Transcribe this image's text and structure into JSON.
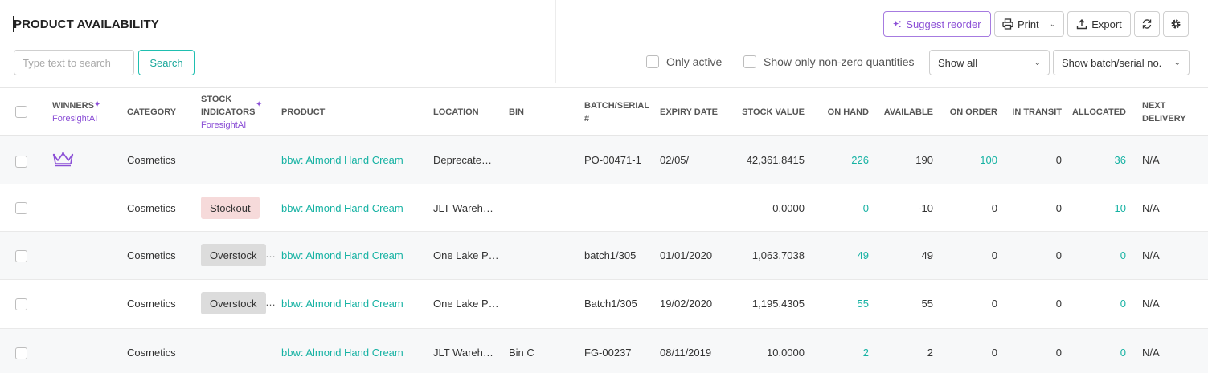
{
  "header": {
    "title": "PRODUCT AVAILABILITY",
    "search_placeholder": "Type text to search",
    "search_label": "Search",
    "suggest_label": "Suggest reorder",
    "print_label": "Print",
    "export_label": "Export",
    "only_active_label": "Only active",
    "non_zero_label": "Show only non-zero quantities",
    "show_all_value": "Show all",
    "batch_value": "Show batch/serial no."
  },
  "columns": {
    "winners": "WINNERS",
    "winners_sub": "ForesightAI",
    "category": "CATEGORY",
    "stock_indicators_1": "STOCK",
    "stock_indicators_2": "INDICATORS",
    "stock_indicators_sub": "ForesightAI",
    "product": "PRODUCT",
    "location": "LOCATION",
    "bin": "BIN",
    "batch_1": "BATCH/SERIAL",
    "batch_2": "#",
    "expiry": "EXPIRY DATE",
    "stock_value": "STOCK VALUE",
    "on_hand": "ON HAND",
    "available": "AVAILABLE",
    "on_order": "ON ORDER",
    "in_transit": "IN TRANSIT",
    "allocated": "ALLOCATED",
    "next_1": "NEXT",
    "next_2": "DELIVERY"
  },
  "rows": [
    {
      "winner": true,
      "category": "Cosmetics",
      "indicator": "",
      "indicator_type": "",
      "product": "bbw: Almond Hand Cream",
      "location": "Deprecate…",
      "bin": "",
      "batch": "PO-00471-1",
      "expiry": "02/05/",
      "stock_value": "42,361.8415",
      "on_hand": "226",
      "available": "190",
      "on_order": "100",
      "in_transit": "0",
      "allocated": "36",
      "next_delivery": "N/A"
    },
    {
      "winner": false,
      "category": "Cosmetics",
      "indicator": "Stockout",
      "indicator_type": "stockout",
      "product": "bbw: Almond Hand Cream",
      "location": "JLT Wareh…",
      "bin": "",
      "batch": "",
      "expiry": "",
      "stock_value": "0.0000",
      "on_hand": "0",
      "available": "-10",
      "on_order": "0",
      "in_transit": "0",
      "allocated": "10",
      "next_delivery": "N/A"
    },
    {
      "winner": false,
      "category": "Cosmetics",
      "indicator": "Overstock",
      "indicator_type": "overstock",
      "product": "bbw: Almond Hand Cream",
      "location": "One Lake P…",
      "bin": "",
      "batch": "batch1/305",
      "expiry": "01/01/2020",
      "stock_value": "1,063.7038",
      "on_hand": "49",
      "available": "49",
      "on_order": "0",
      "in_transit": "0",
      "allocated": "0",
      "next_delivery": "N/A"
    },
    {
      "winner": false,
      "category": "Cosmetics",
      "indicator": "Overstock",
      "indicator_type": "overstock",
      "product": "bbw: Almond Hand Cream",
      "location": "One Lake P…",
      "bin": "",
      "batch": "Batch1/305",
      "expiry": "19/02/2020",
      "stock_value": "1,195.4305",
      "on_hand": "55",
      "available": "55",
      "on_order": "0",
      "in_transit": "0",
      "allocated": "0",
      "next_delivery": "N/A"
    },
    {
      "winner": false,
      "category": "Cosmetics",
      "indicator": "",
      "indicator_type": "",
      "product": "bbw: Almond Hand Cream",
      "location": "JLT Wareh…",
      "bin": "Bin C",
      "batch": "FG-00237",
      "expiry": "08/11/2019",
      "stock_value": "10.0000",
      "on_hand": "2",
      "available": "2",
      "on_order": "0",
      "in_transit": "0",
      "allocated": "0",
      "next_delivery": "N/A"
    }
  ],
  "colors": {
    "accent": "#16b2a3",
    "ai_purple": "#8b4fd6",
    "stockout": "#f6dada",
    "overstock": "#dcdcdc"
  }
}
